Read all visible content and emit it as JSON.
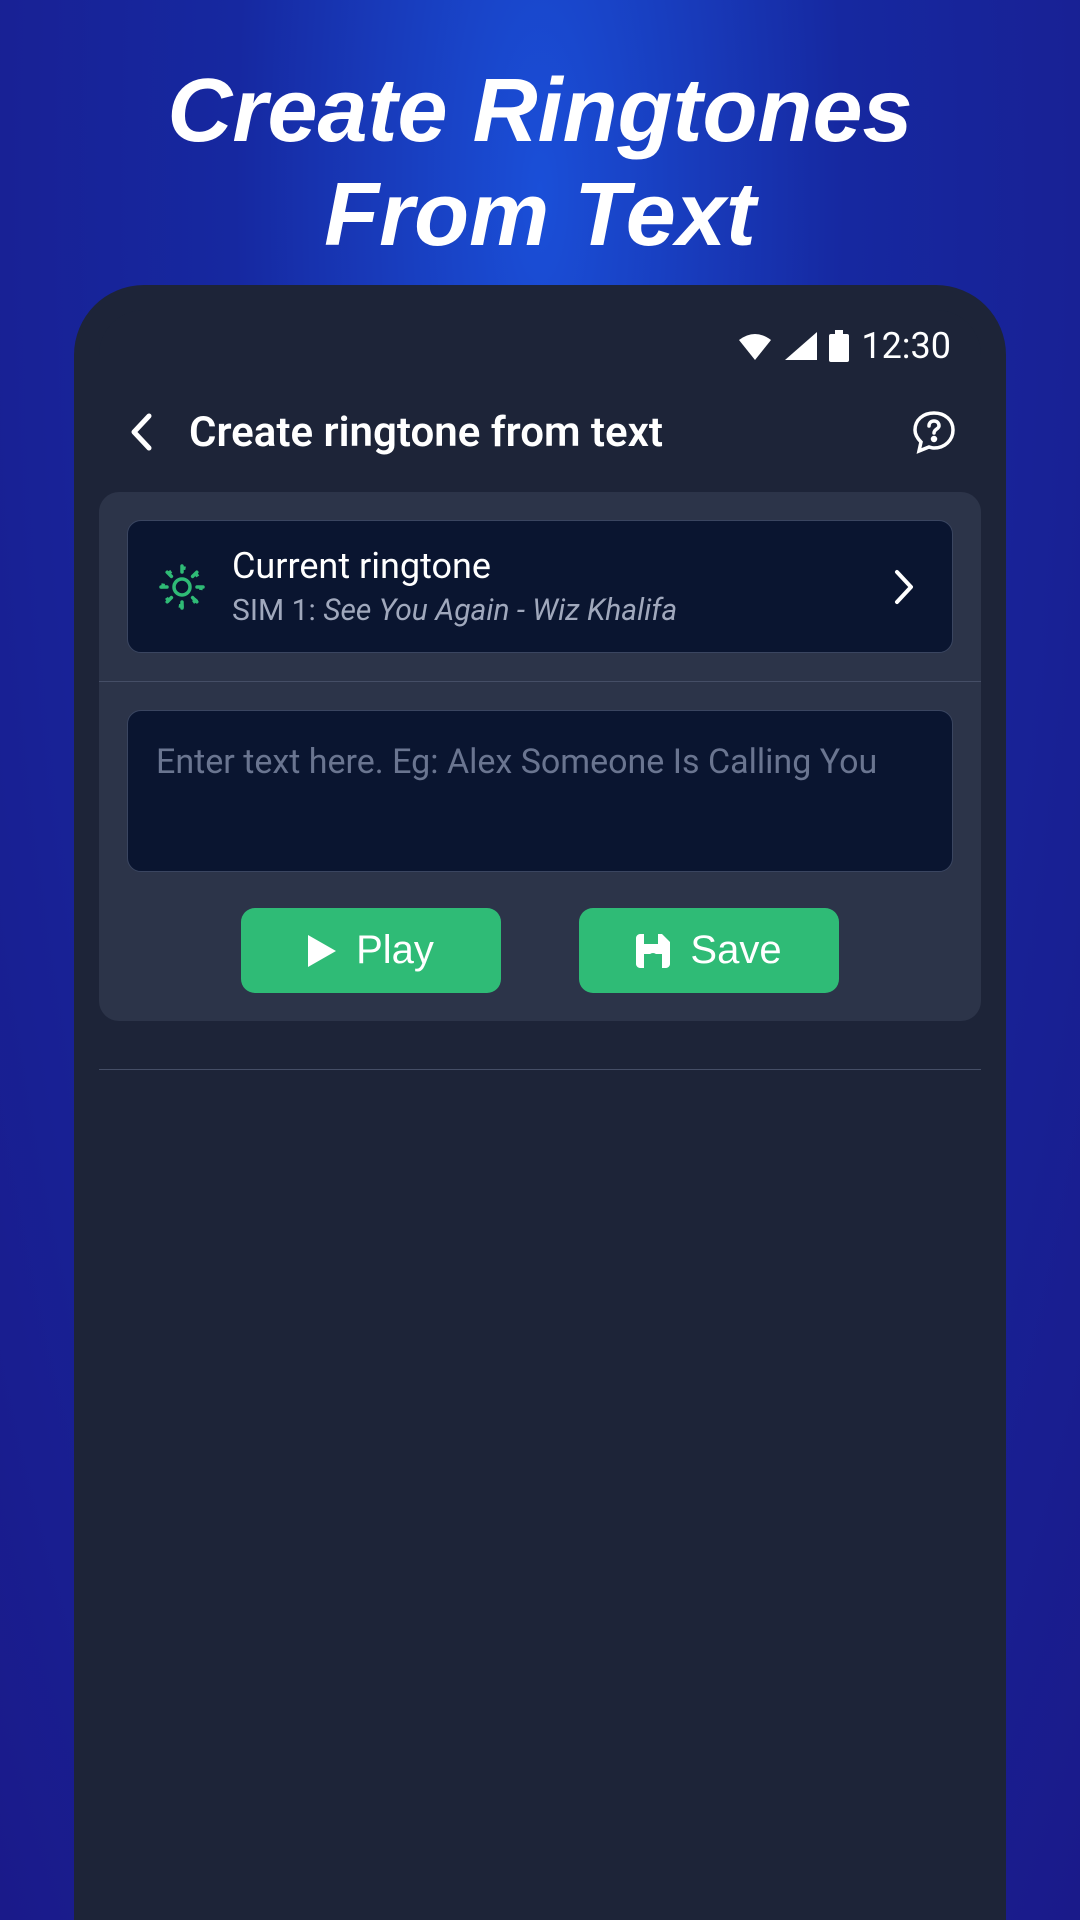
{
  "hero": {
    "line1": "Create Ringtones",
    "line2": "From Text"
  },
  "status_bar": {
    "time": "12:30"
  },
  "header": {
    "title": "Create ringtone from text"
  },
  "ringtone_card": {
    "label": "Current ringtone",
    "sim_label": "SIM 1:",
    "song": "See You Again - Wiz Khalifa"
  },
  "text_input": {
    "placeholder": "Enter text here. Eg: Alex Someone Is Calling You"
  },
  "buttons": {
    "play": "Play",
    "save": "Save"
  }
}
